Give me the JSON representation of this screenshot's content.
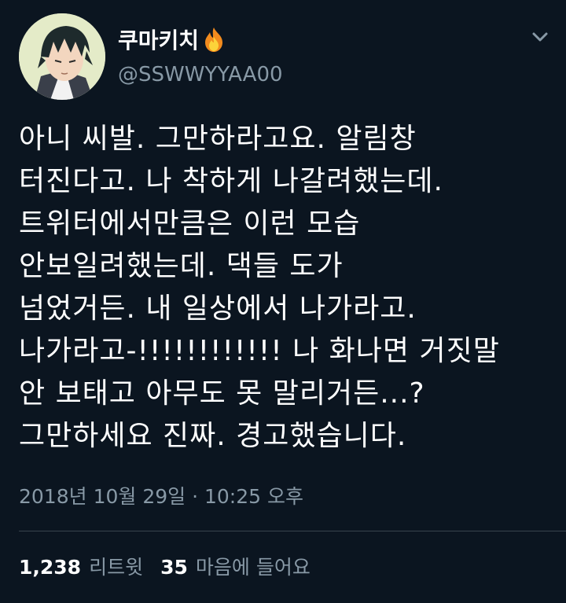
{
  "user": {
    "display_name": "쿠마키치",
    "handle": "@SSWWYYAA00",
    "avatar_icon": "avatar-illustration",
    "name_badge_icon": "fire-emoji"
  },
  "tweet": {
    "lines": [
      "아니 씨발. 그만하라고요. 알림창",
      "터진다고. 나 착하게 나갈려했는데.",
      "트위터에서만큼은 이런 모습",
      "안보일려했는데. 댁들 도가",
      "넘었거든. 내 일상에서 나가라고.",
      "나가라고-!!!!!!!!!!!! 나 화나면 거짓말",
      "안 보태고 아무도 못 말리거든...?",
      "그만하세요 진짜. 경고했습니다."
    ],
    "timestamp": "2018년 10월 29일 · 10:25 오후"
  },
  "stats": {
    "retweets_count": "1,238",
    "retweets_label": "리트윗",
    "likes_count": "35",
    "likes_label": "마음에 들어요"
  },
  "colors": {
    "background": "#0b1520",
    "text": "#ffffff",
    "secondary_text": "#8899a6",
    "divider": "#38444d"
  }
}
